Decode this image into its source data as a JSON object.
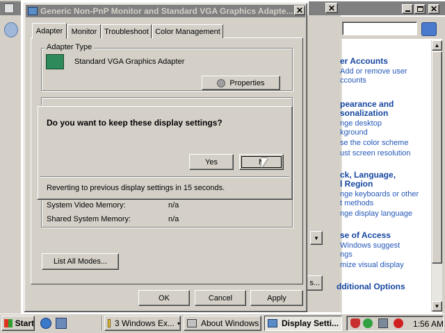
{
  "control_panel": {
    "heading_user_accounts": "er Accounts",
    "link_add_remove": "Add or remove user",
    "link_accounts": "ccounts",
    "heading_appearance": "pearance and",
    "heading_personalization": "sonalization",
    "link_desktop": "nge desktop",
    "link_background": "kground",
    "link_color_scheme": "se the color scheme",
    "link_resolution": "ust screen resolution",
    "heading_language": "ck, Language,",
    "heading_region": "l Region",
    "link_keyboards": "nge keyboards or other",
    "link_input": "t methods",
    "link_display_language": "nge display language",
    "heading_access": "se of Access",
    "link_suggest": "Windows suggest",
    "link_ngs": "ngs",
    "link_visual": "mize visual display",
    "heading_additional": "dditional Options",
    "partial_button": "s..."
  },
  "dialog": {
    "title": "Generic Non-PnP Monitor and Standard VGA Graphics Adapte...",
    "tabs": [
      "Adapter",
      "Monitor",
      "Troubleshoot",
      "Color Management"
    ],
    "adapter_type_label": "Adapter Type",
    "adapter_name": "Standard VGA Graphics Adapter",
    "properties_label": "Properties",
    "info": [
      {
        "label": "System Video Memory:",
        "value": "n/a"
      },
      {
        "label": "Shared System Memory:",
        "value": "n/a"
      }
    ],
    "list_modes_label": "List All Modes...",
    "ok_label": "OK",
    "cancel_label": "Cancel",
    "apply_label": "Apply"
  },
  "confirm": {
    "question": "Do you want to keep these display settings?",
    "yes_label": "Yes",
    "no_label": "N",
    "revert_text": "Reverting to previous display settings in 15 seconds."
  },
  "taskbar": {
    "start_label": "Start",
    "tasks": [
      "3 Windows Ex...",
      "About Windows",
      "Display Setti..."
    ],
    "clock": "1:56 AM"
  },
  "colors": {
    "face": "#d4d0c8",
    "inactive_title": "#808080",
    "link_blue": "#2458b8"
  }
}
